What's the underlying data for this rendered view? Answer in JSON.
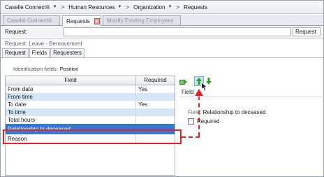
{
  "breadcrumb": {
    "items": [
      "Caselle Connect®",
      "Human Resources",
      "Organization",
      "Requests"
    ]
  },
  "tabs": [
    {
      "label": "Caselle Connect®",
      "active": false
    },
    {
      "label": "Requests",
      "active": true,
      "closable": true
    },
    {
      "label": "Modify Existing Employees",
      "active": false
    }
  ],
  "request_bar": {
    "label": "Request:",
    "value": "",
    "button_label": "Request"
  },
  "request_desc": "Request: Leave - Bereavement",
  "subtabs": [
    {
      "label": "Request",
      "active": false
    },
    {
      "label": "Fields",
      "active": true
    },
    {
      "label": "Requesters",
      "active": false
    }
  ],
  "id_fields": {
    "label": "Identification fields:",
    "value": "Position"
  },
  "grid": {
    "headers": [
      "Field",
      "Required"
    ],
    "rows": [
      {
        "field": "From date",
        "required": "Yes",
        "state": "normal"
      },
      {
        "field": "From time",
        "required": "",
        "state": "alt"
      },
      {
        "field": "To date",
        "required": "Yes",
        "state": "normal"
      },
      {
        "field": "To time",
        "required": "",
        "state": "alt"
      },
      {
        "field": "Total hours",
        "required": "",
        "state": "normal"
      },
      {
        "field": "Relationship to deceased",
        "required": "",
        "state": "selected"
      },
      {
        "field": "Reason",
        "required": "",
        "state": "normal"
      }
    ]
  },
  "right_panel": {
    "header": "Field",
    "detail_label": "Field:",
    "detail_value": "Relationship to deceased",
    "required_label": "Required",
    "required_checked": false
  },
  "colors": {
    "selection": "#3478d2",
    "alt_row": "#d6e6f6",
    "highlight": "#e52525"
  }
}
